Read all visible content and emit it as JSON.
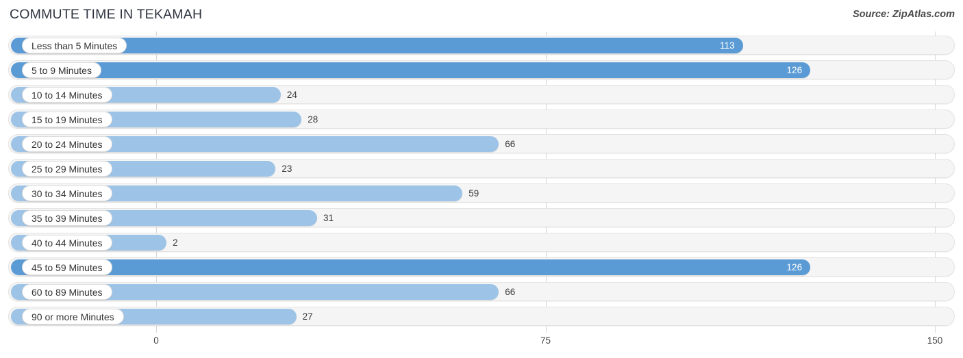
{
  "header": {
    "title": "COMMUTE TIME IN TEKAMAH",
    "source": "Source: ZipAtlas.com"
  },
  "colors": {
    "bar_dark": "#5b9bd5",
    "bar_light": "#9dc3e6",
    "track": "#f5f5f5",
    "gridline": "#d8d8d8",
    "value_inside": "#ffffff",
    "value_outside": "#3a3a3a"
  },
  "chart_data": {
    "type": "bar",
    "orientation": "horizontal",
    "title": "COMMUTE TIME IN TEKAMAH",
    "subtitle": "",
    "xlabel": "",
    "ylabel": "",
    "xlim": [
      0,
      150
    ],
    "xticks": [
      0,
      75,
      150
    ],
    "xtick_labels": [
      "0",
      "75",
      "150"
    ],
    "grid": true,
    "legend": false,
    "categories": [
      "Less than 5 Minutes",
      "5 to 9 Minutes",
      "10 to 14 Minutes",
      "15 to 19 Minutes",
      "20 to 24 Minutes",
      "25 to 29 Minutes",
      "30 to 34 Minutes",
      "35 to 39 Minutes",
      "40 to 44 Minutes",
      "45 to 59 Minutes",
      "60 to 89 Minutes",
      "90 or more Minutes"
    ],
    "values": [
      113,
      126,
      24,
      28,
      66,
      23,
      59,
      31,
      2,
      126,
      66,
      27
    ],
    "value_labels": [
      "113",
      "126",
      "24",
      "28",
      "66",
      "23",
      "59",
      "31",
      "2",
      "126",
      "66",
      "27"
    ],
    "bars": [
      {
        "label": "Less than 5 Minutes",
        "value": 113,
        "value_label": "113",
        "shade": "dark",
        "label_inside": true
      },
      {
        "label": "5 to 9 Minutes",
        "value": 126,
        "value_label": "126",
        "shade": "dark",
        "label_inside": true
      },
      {
        "label": "10 to 14 Minutes",
        "value": 24,
        "value_label": "24",
        "shade": "light",
        "label_inside": false
      },
      {
        "label": "15 to 19 Minutes",
        "value": 28,
        "value_label": "28",
        "shade": "light",
        "label_inside": false
      },
      {
        "label": "20 to 24 Minutes",
        "value": 66,
        "value_label": "66",
        "shade": "light",
        "label_inside": false
      },
      {
        "label": "25 to 29 Minutes",
        "value": 23,
        "value_label": "23",
        "shade": "light",
        "label_inside": false
      },
      {
        "label": "30 to 34 Minutes",
        "value": 59,
        "value_label": "59",
        "shade": "light",
        "label_inside": false
      },
      {
        "label": "35 to 39 Minutes",
        "value": 31,
        "value_label": "31",
        "shade": "light",
        "label_inside": false
      },
      {
        "label": "40 to 44 Minutes",
        "value": 2,
        "value_label": "2",
        "shade": "light",
        "label_inside": false
      },
      {
        "label": "45 to 59 Minutes",
        "value": 126,
        "value_label": "126",
        "shade": "dark",
        "label_inside": true
      },
      {
        "label": "60 to 89 Minutes",
        "value": 66,
        "value_label": "66",
        "shade": "light",
        "label_inside": false
      },
      {
        "label": "90 or more Minutes",
        "value": 27,
        "value_label": "27",
        "shade": "light",
        "label_inside": false
      }
    ]
  }
}
